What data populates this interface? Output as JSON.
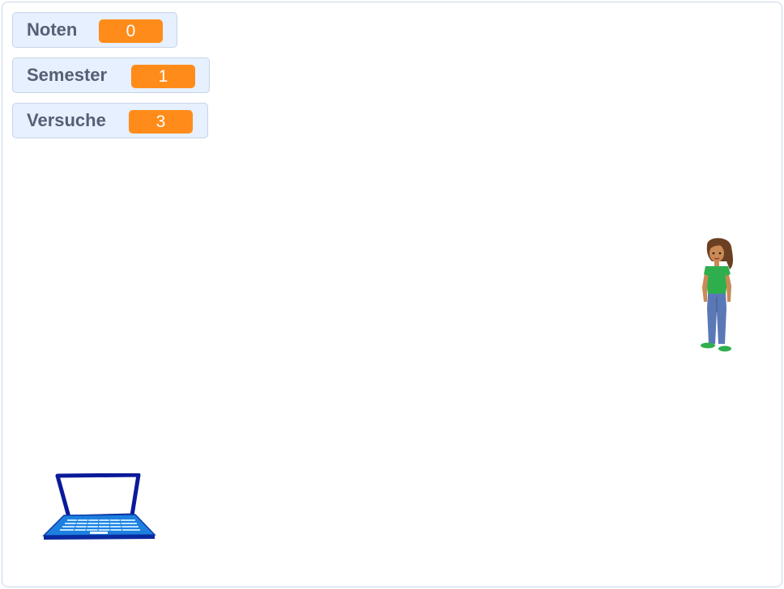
{
  "stage": {
    "background": "#ffffff",
    "border_color": "#c9d6ea"
  },
  "monitors": [
    {
      "label": "Noten",
      "value": "0"
    },
    {
      "label": "Semester",
      "value": "1"
    },
    {
      "label": "Versuche",
      "value": "3"
    }
  ],
  "colors": {
    "monitor_background": "#e6f0ff",
    "monitor_label": "#575e75",
    "value_accent": "#ff8c1a"
  },
  "sprites": [
    {
      "name": "laptop",
      "icon": "laptop-icon"
    },
    {
      "name": "girl",
      "icon": "girl-character-icon"
    }
  ]
}
